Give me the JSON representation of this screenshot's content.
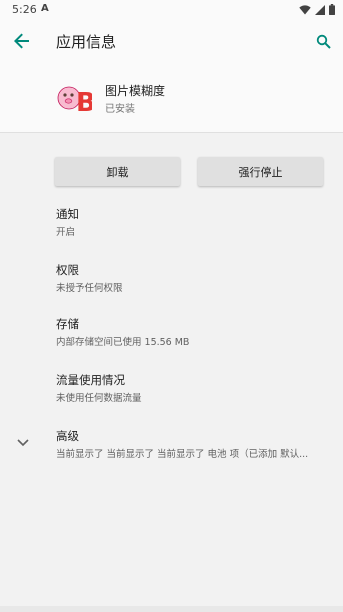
{
  "status_bar": {
    "time": "5:26",
    "notification_glyph": "A"
  },
  "app_bar": {
    "title": "应用信息"
  },
  "app": {
    "name": "图片模糊度",
    "status": "已安装",
    "icon_letter": "B"
  },
  "buttons": {
    "uninstall": "卸载",
    "force_stop": "强行停止"
  },
  "prefs": [
    {
      "title": "通知",
      "summary": "开启"
    },
    {
      "title": "权限",
      "summary": "未授予任何权限"
    },
    {
      "title": "存储",
      "summary": "内部存储空间已使用 15.56 MB"
    },
    {
      "title": "流量使用情况",
      "summary": "未使用任何数据流量"
    },
    {
      "title": "高级",
      "summary": "当前显示了 当前显示了 当前显示了 电池 项（已添加 默认..."
    }
  ],
  "colors": {
    "accent": "#00897b",
    "app_icon_red": "#e53935",
    "app_icon_pink": "#f8bbd0"
  }
}
